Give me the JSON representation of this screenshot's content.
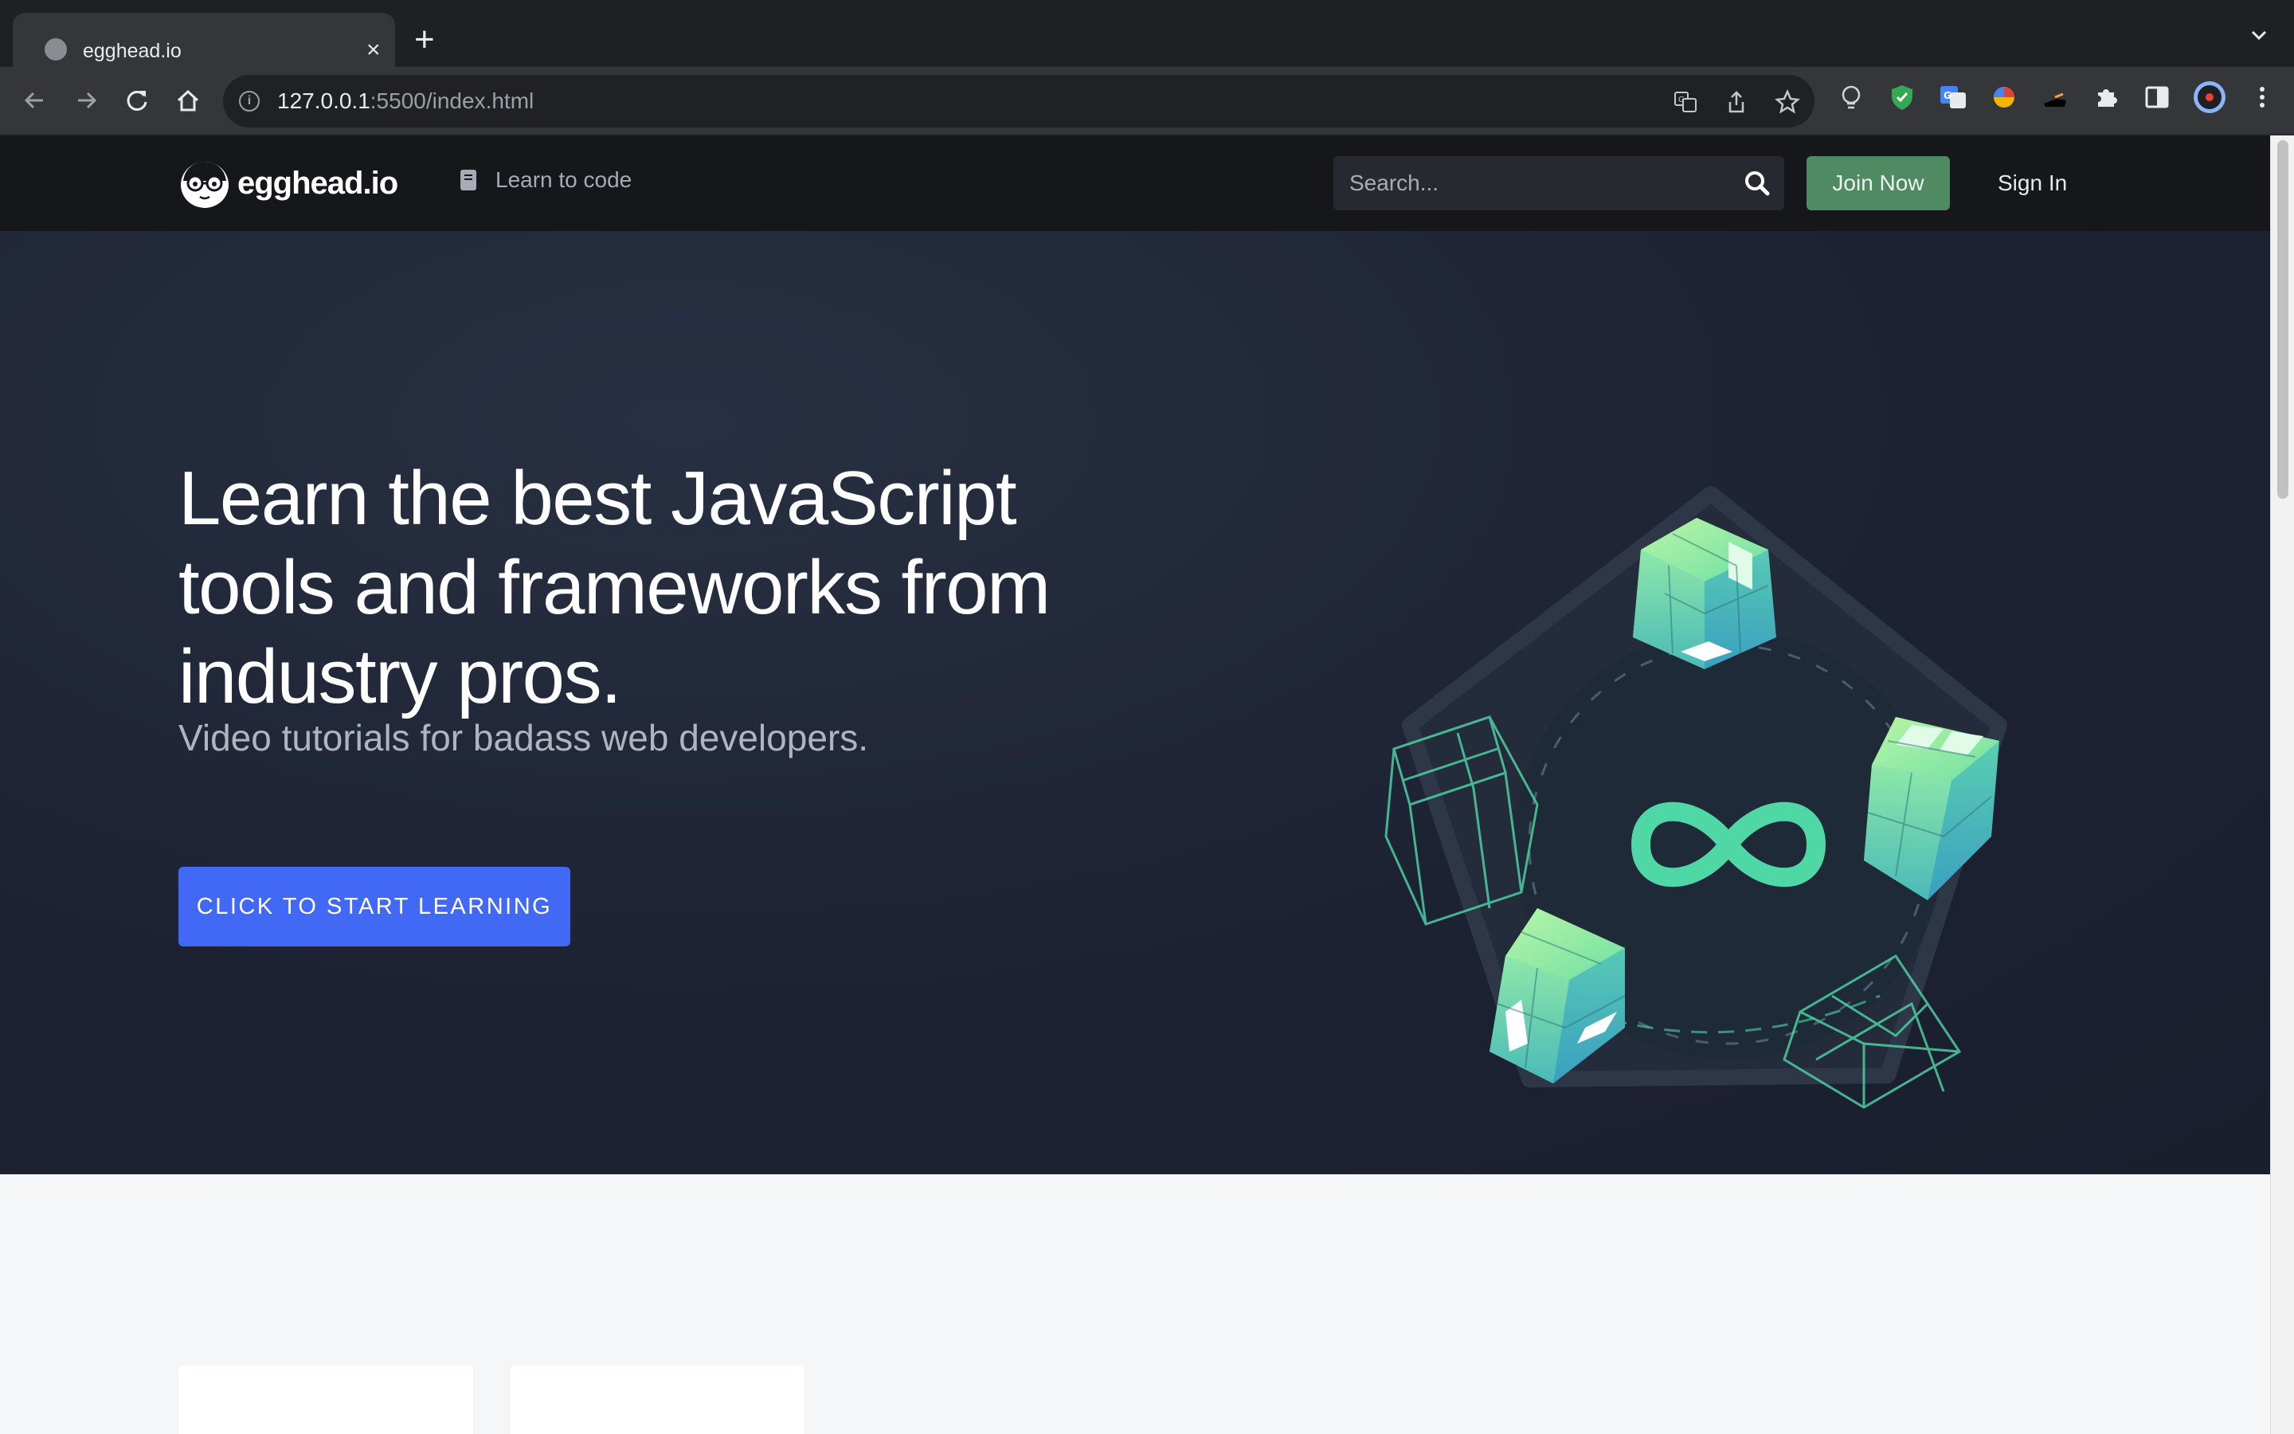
{
  "browser": {
    "tab_title": "egghead.io",
    "tab_close": "×",
    "new_tab": "+",
    "url_host": "127.0.0.1",
    "url_rest": ":5500/index.html",
    "icons": [
      "globe-icon",
      "close-icon",
      "plus-icon",
      "chevron-down-icon",
      "back-icon",
      "forward-icon",
      "reload-icon",
      "home-icon",
      "info-icon",
      "translate-icon",
      "share-icon",
      "star-icon",
      "lightbulb-extension-icon",
      "shield-extension-icon",
      "google-translate-extension-icon",
      "color-picker-extension-icon",
      "extension-icon",
      "puzzle-icon",
      "side-panel-icon",
      "profile-avatar-icon",
      "more-vert-icon"
    ]
  },
  "site": {
    "logo_text": "egghead.io",
    "nav": {
      "learn_label": "Learn to code"
    },
    "search": {
      "placeholder": "Search..."
    },
    "join_label": "Join Now",
    "signin_label": "Sign In"
  },
  "hero": {
    "title": "Learn the best JavaScript tools and frameworks from industry pros.",
    "subtitle": "Video tutorials for badass web developers.",
    "cta_label": "CLICK TO START LEARNING"
  },
  "colors": {
    "nav_bg": "#16171b",
    "hero_bg": "#1d2233",
    "join_green": "#4f8a63",
    "cta_blue": "#4268f6",
    "accent_mint": "#4fd8a6"
  }
}
